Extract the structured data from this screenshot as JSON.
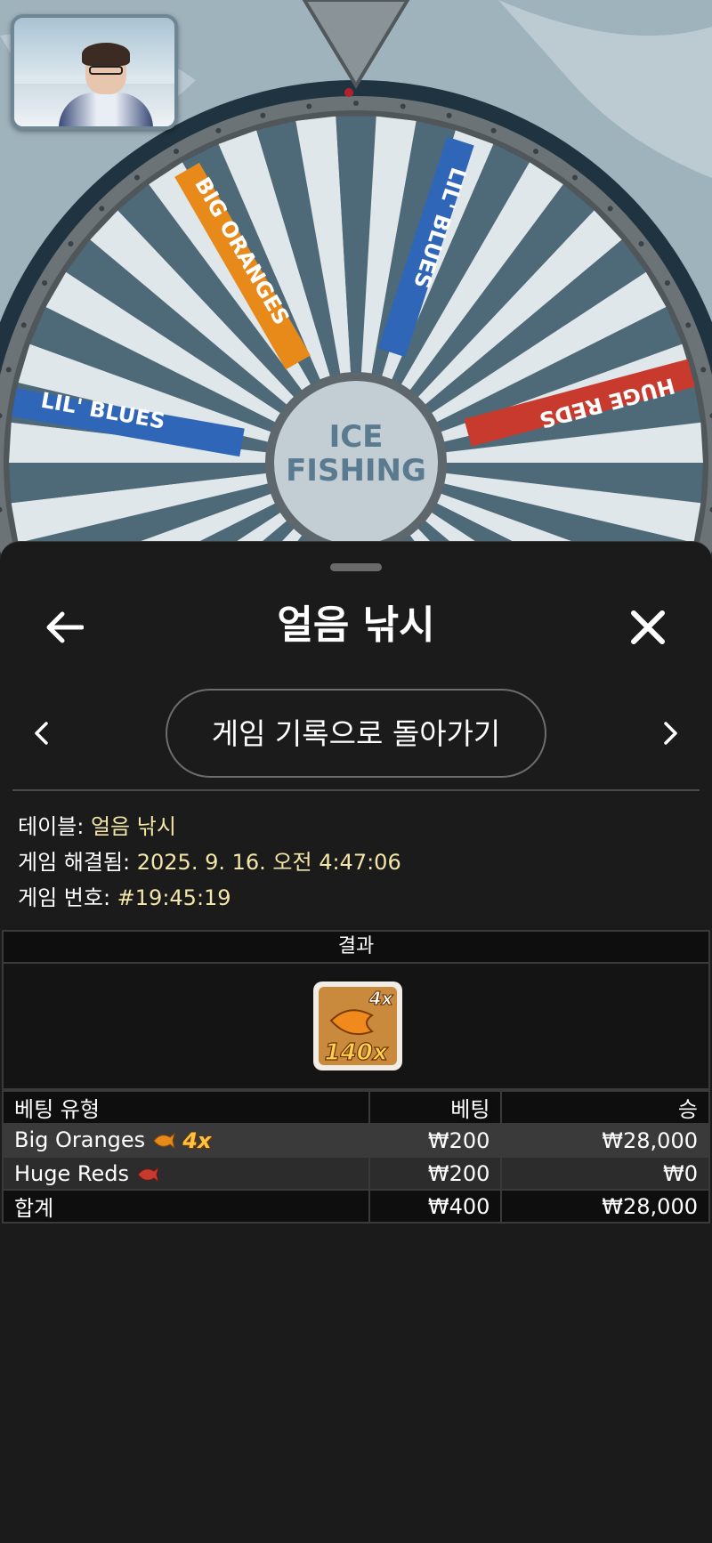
{
  "game_scene": {
    "wheel_center_line1": "ICE",
    "wheel_center_line2": "FISHING",
    "segments": {
      "big_oranges": "BIG ORANGES",
      "lil_blues_right": "LIL' BLUES",
      "lil_blues_left": "LIL' BLUES",
      "huge_reds": "HUGE REDS"
    }
  },
  "header": {
    "title": "얼음 낚시"
  },
  "nav": {
    "history_button_label": "게임 기록으로 돌아가기"
  },
  "info": {
    "table_label": "테이블: ",
    "table_value": "얼음 낚시",
    "resolved_label": "게임 해결됨: ",
    "resolved_value": "2025. 9. 16. 오전 4:47:06",
    "number_label": "게임 번호: ",
    "number_value": "#19:45:19"
  },
  "results": {
    "header": "결과",
    "tile_multiplier_top": "4x",
    "tile_multiplier_bottom": "140x"
  },
  "bets": {
    "col_type": "베팅 유형",
    "col_bet": "베팅",
    "col_win": "승",
    "rows": [
      {
        "type": "Big Oranges",
        "badge": "4x",
        "bet": "₩200",
        "win": "₩28,000"
      },
      {
        "type": "Huge Reds",
        "badge": "",
        "bet": "₩200",
        "win": "₩0"
      }
    ],
    "total_label": "합계",
    "total_bet": "₩400",
    "total_win": "₩28,000"
  },
  "colors": {
    "background": "#1b1b1b",
    "info_value": "#f3e6a8",
    "orange_fish": "#e88a1a",
    "red_fish": "#c83a2e",
    "blue_fish": "#2f66b8"
  }
}
